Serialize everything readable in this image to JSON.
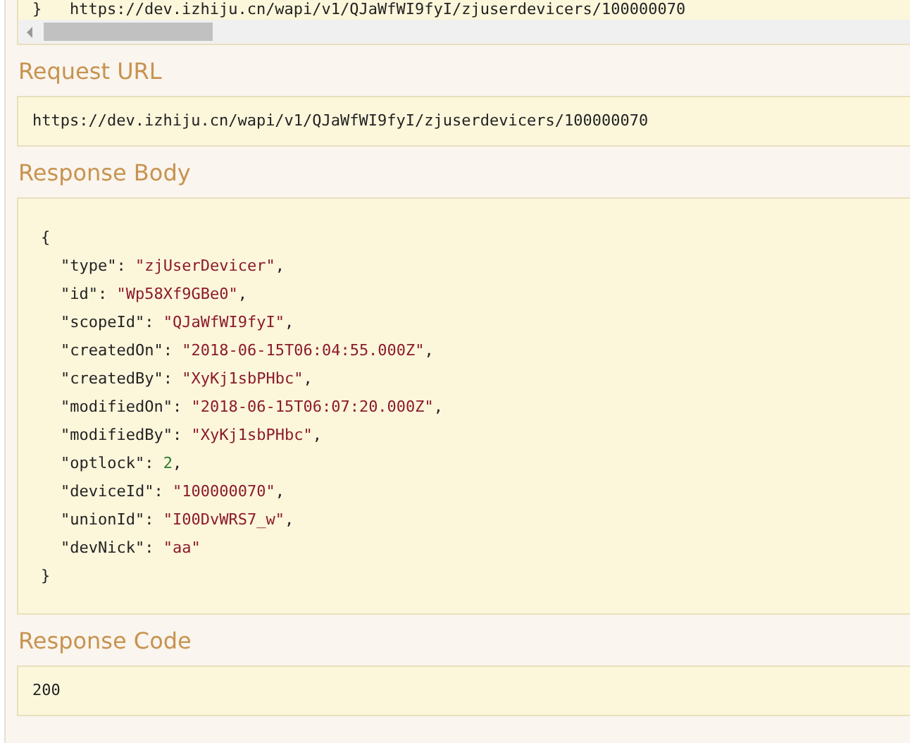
{
  "curl_block": {
    "text": "}   https://dev.izhiju.cn/wapi/v1/QJaWfWI9fyI/zjuserdevicers/100000070"
  },
  "request_url": {
    "heading": "Request URL",
    "value": "https://dev.izhiju.cn/wapi/v1/QJaWfWI9fyI/zjuserdevicers/100000070"
  },
  "response_body": {
    "heading": "Response Body",
    "open": "{",
    "close": "}",
    "lines": [
      {
        "key": "\"type\"",
        "sep": ": ",
        "value": "\"zjUserDevicer\"",
        "kind": "string",
        "punct": ","
      },
      {
        "key": "\"id\"",
        "sep": ": ",
        "value": "\"Wp58Xf9GBe0\"",
        "kind": "string",
        "punct": ","
      },
      {
        "key": "\"scopeId\"",
        "sep": ": ",
        "value": "\"QJaWfWI9fyI\"",
        "kind": "string",
        "punct": ","
      },
      {
        "key": "\"createdOn\"",
        "sep": ": ",
        "value": "\"2018-06-15T06:04:55.000Z\"",
        "kind": "string",
        "punct": ","
      },
      {
        "key": "\"createdBy\"",
        "sep": ": ",
        "value": "\"XyKj1sbPHbc\"",
        "kind": "string",
        "punct": ","
      },
      {
        "key": "\"modifiedOn\"",
        "sep": ": ",
        "value": "\"2018-06-15T06:07:20.000Z\"",
        "kind": "string",
        "punct": ","
      },
      {
        "key": "\"modifiedBy\"",
        "sep": ": ",
        "value": "\"XyKj1sbPHbc\"",
        "kind": "string",
        "punct": ","
      },
      {
        "key": "\"optlock\"",
        "sep": ": ",
        "value": "2",
        "kind": "number",
        "punct": ","
      },
      {
        "key": "\"deviceId\"",
        "sep": ": ",
        "value": "\"100000070\"",
        "kind": "string",
        "punct": ","
      },
      {
        "key": "\"unionId\"",
        "sep": ": ",
        "value": "\"I00DvWRS7_w\"",
        "kind": "string",
        "punct": ","
      },
      {
        "key": "\"devNick\"",
        "sep": ": ",
        "value": "\"aa\"",
        "kind": "string"
      }
    ]
  },
  "response_code": {
    "heading": "Response Code",
    "value": "200"
  }
}
